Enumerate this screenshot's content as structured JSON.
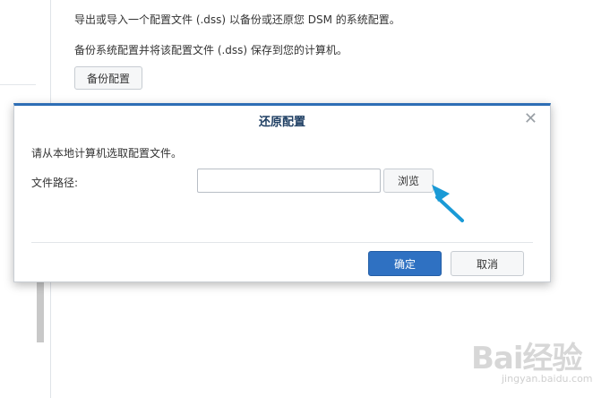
{
  "background": {
    "line1": "导出或导入一个配置文件 (.dss) 以备份或还原您 DSM 的系统配置。",
    "line2": "备份系统配置并将该配置文件 (.dss) 保存到您的计算机。",
    "backup_button": "备份配置"
  },
  "dialog": {
    "title": "还原配置",
    "close_glyph": "✕",
    "description": "请从本地计算机选取配置文件。",
    "path_label": "文件路径:",
    "path_value": "",
    "browse_button": "浏览",
    "ok_button": "确定",
    "cancel_button": "取消"
  },
  "watermark": {
    "brand": "Bai经验",
    "url": "jingyan.baidu.com"
  },
  "colors": {
    "accent": "#2f71c2",
    "annotation_arrow": "#1a9ad6"
  }
}
